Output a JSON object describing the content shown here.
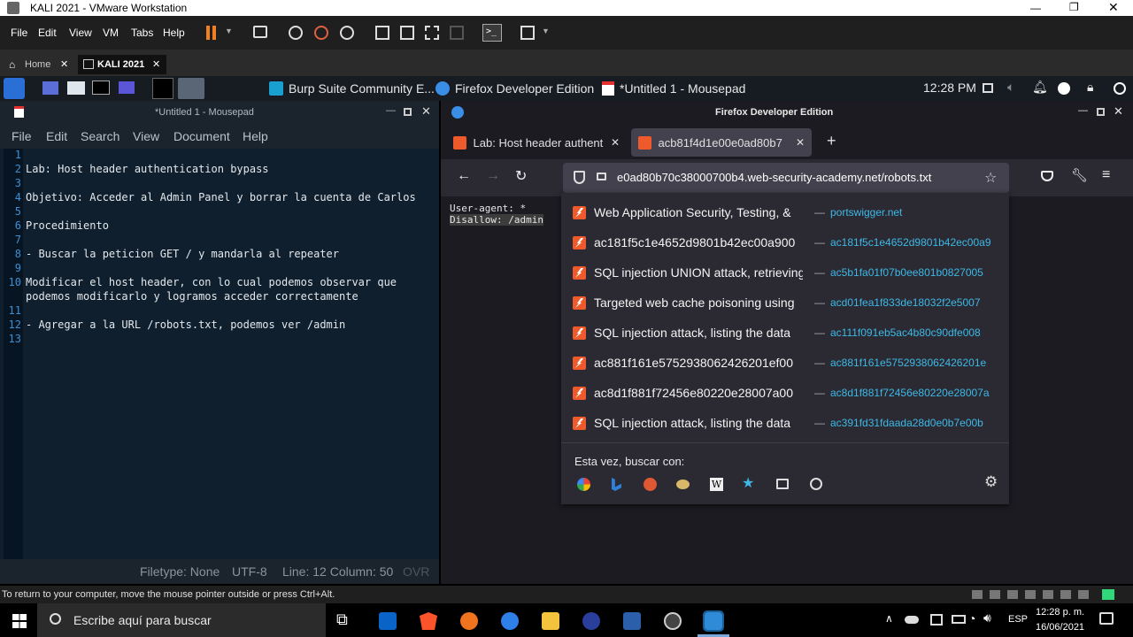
{
  "vmware": {
    "title": "KALI 2021 - VMware Workstation",
    "menu": [
      "File",
      "Edit",
      "View",
      "VM",
      "Tabs",
      "Help"
    ],
    "tabs": [
      {
        "label": "Home"
      },
      {
        "label": "KALI 2021"
      }
    ],
    "hint": "To return to your computer, move the mouse pointer outside or press Ctrl+Alt."
  },
  "kali_panel": {
    "tasks": [
      {
        "label": "Burp Suite Community E...",
        "icon": "burp-icon"
      },
      {
        "label": "Firefox Developer Edition",
        "icon": "firefox-icon"
      },
      {
        "label": "*Untitled 1 - Mousepad",
        "icon": "mousepad-icon"
      }
    ],
    "clock": "12:28 PM"
  },
  "mousepad": {
    "title": "*Untitled 1 - Mousepad",
    "menu": [
      "File",
      "Edit",
      "Search",
      "View",
      "Document",
      "Help"
    ],
    "lines": [
      "",
      "Lab: Host header authentication bypass",
      "",
      "Objetivo: Acceder al Admin Panel y borrar la cuenta de Carlos",
      "",
      "Procedimiento",
      "",
      "- Buscar la peticion GET / y mandarla al repeater",
      "",
      "Modificar el host header, con lo cual podemos observar que",
      "podemos modificarlo y logramos acceder correctamente",
      "",
      "- Agregar a la URL /robots.txt, podemos ver /admin",
      ""
    ],
    "line_numbers": [
      "1",
      "2",
      "3",
      "4",
      "5",
      "6",
      "7",
      "8",
      "9",
      "10",
      "",
      "11",
      "12",
      "13"
    ],
    "status": {
      "filetype": "Filetype: None",
      "encoding": "UTF-8",
      "position": "Line: 12 Column: 50",
      "ovr": "OVR"
    }
  },
  "firefox": {
    "title": "Firefox Developer Edition",
    "tabs": [
      {
        "label": "Lab: Host header authent"
      },
      {
        "label": "acb81f4d1e00e0ad80b7"
      }
    ],
    "url": "e0ad80b70c38000700b4.web-security-academy.net/robots.txt",
    "content_lines": [
      "User-agent: *",
      "Disallow: /admin"
    ],
    "suggestions": [
      {
        "title": "Web Application Security, Testing, &",
        "url": "portswigger.net"
      },
      {
        "title": "ac181f5c1e4652d9801b42ec00a900",
        "url": "ac181f5c1e4652d9801b42ec00a9"
      },
      {
        "title": "SQL injection UNION attack, retrieving",
        "url": "ac5b1fa01f07b0ee801b0827005"
      },
      {
        "title": "Targeted web cache poisoning using",
        "url": "acd01fea1f833de18032f2e5007"
      },
      {
        "title": "SQL injection attack, listing the data",
        "url": "ac111f091eb5ac4b80c90dfe008"
      },
      {
        "title": "ac881f161e5752938062426201ef00",
        "url": "ac881f161e5752938062426201e"
      },
      {
        "title": "ac8d1f881f72456e80220e28007a00",
        "url": "ac8d1f881f72456e80220e28007a"
      },
      {
        "title": "SQL injection attack, listing the data",
        "url": "ac391fd31fdaada28d0e0b7e00b"
      }
    ],
    "search_with": "Esta vez, buscar con:"
  },
  "windows": {
    "search_placeholder": "Escribe aquí para buscar",
    "lang": "ESP",
    "time": "12:28 p. m.",
    "date": "16/06/2021"
  }
}
